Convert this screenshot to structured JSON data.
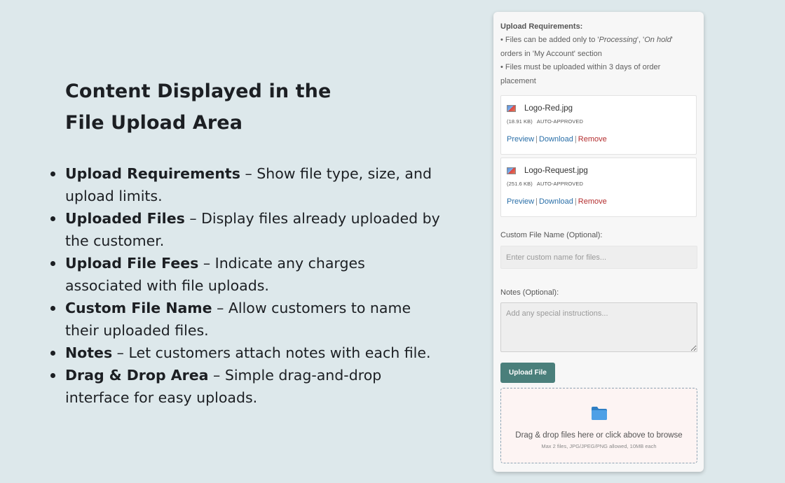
{
  "intro": {
    "heading": "Content Displayed in the File Upload Area",
    "features": [
      {
        "term": "Upload Requirements",
        "desc": " – Show file type, size, and upload limits."
      },
      {
        "term": "Uploaded Files",
        "desc": " – Display files already uploaded by the customer."
      },
      {
        "term": "Upload File Fees",
        "desc": " – Indicate any charges associated with file uploads."
      },
      {
        "term": "Custom File Name",
        "desc": " – Allow customers to name their uploaded files."
      },
      {
        "term": "Notes",
        "desc": " – Let customers attach notes with each file."
      },
      {
        "term": "Drag & Drop Area",
        "desc": " – Simple drag-and-drop interface for easy uploads."
      }
    ]
  },
  "panel": {
    "requirements": {
      "title": "Upload Requirements:",
      "line1_prefix": "• Files can be added only to '",
      "line1_em1": "Processing",
      "line1_mid": "', '",
      "line1_em2": "On hold",
      "line1_suffix": "' orders in 'My Account' section",
      "line2": "• Files must be uploaded within 3 days of order placement"
    },
    "files": [
      {
        "name": "Logo-Red.jpg",
        "size": "(18.91 KB)",
        "status": "Auto-approved"
      },
      {
        "name": "Logo-Request.jpg",
        "size": "(251.6 KB)",
        "status": "Auto-approved"
      }
    ],
    "actions": {
      "preview": "Preview",
      "download": "Download",
      "remove": "Remove",
      "separator": "|"
    },
    "custom_name": {
      "label": "Custom File Name (Optional):",
      "placeholder": "Enter custom name for files..."
    },
    "notes": {
      "label": "Notes (Optional):",
      "placeholder": "Add any special instructions..."
    },
    "upload_button": "Upload File",
    "drop_zone": {
      "icon": "folder-icon",
      "text": "Drag & drop files here or click above to browse",
      "subtext": "Max 2 files, JPG/JPEG/PNG allowed, 10MB each"
    }
  },
  "colors": {
    "background": "#dde8eb",
    "accent_button": "#4a7f7b",
    "link": "#2a6fa8",
    "remove_link": "#b32d2e",
    "folder_icon": "#3f93d9"
  }
}
